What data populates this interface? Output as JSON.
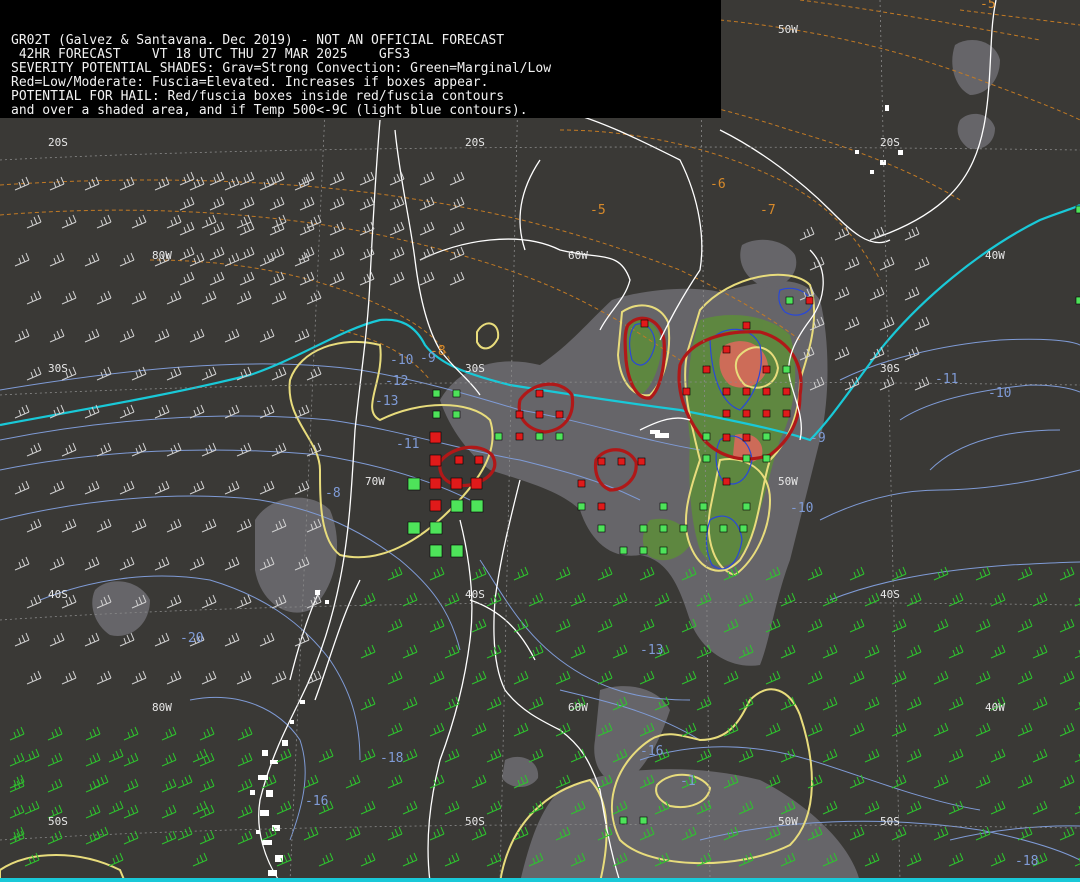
{
  "header": {
    "lines": [
      "GR02T (Galvez & Santavana. Dec 2019) - NOT AN OFFICIAL FORECAST",
      " 42HR FORECAST    VT 18 UTC THU 27 MAR 2025    GFS3",
      "SEVERITY POTENTIAL SHADES: Grav=Strong Convection: Green=Marginal/Low",
      "Red=Low/Moderate: Fuscia=Elevated. Increases if boxes appear.",
      "POTENTIAL FOR HAIL: Red/fuscia boxes inside red/fuscia contours",
      "and over a shaded area, and if Temp 500<-9C (light blue contours)."
    ]
  },
  "grid_labels": {
    "lat_20s_a": "20S",
    "lat_20s_b": "20S",
    "lat_20s_c": "20S",
    "lat_30s_a": "30S",
    "lat_30s_b": "30S",
    "lat_30s_c": "30S",
    "lat_40s_a": "40S",
    "lat_40s_b": "40S",
    "lat_40s_c": "40S",
    "lat_50s_a": "50S",
    "lat_50s_b": "50S",
    "lat_50s_c": "50S",
    "lon_80w_a": "80W",
    "lon_80w_b": "80W",
    "lon_70w": "70W",
    "lon_60w_a": "60W",
    "lon_60w_b": "60W",
    "lon_50w_a": "50W",
    "lon_50w_b": "50W",
    "lon_50w_c": "50W",
    "lon_40w_a": "40W",
    "lon_40w_b": "40W"
  },
  "temp_labels": {
    "t1": "-10",
    "t2": "-12",
    "t3": "-13",
    "t4": "-11",
    "t5": "-8",
    "t6": "-20",
    "t7": "-13",
    "t8": "-18",
    "t9": "-16",
    "t10": "-16",
    "t11": "-11",
    "t12": "-10",
    "t13": "-10",
    "t14": "-18",
    "t15": "-9",
    "t16": "-9",
    "t17": "-1"
  },
  "other_labels": {
    "o1": "-5",
    "o2": "-6",
    "o3": "-7",
    "o4": "-8",
    "o5": "-5"
  },
  "colors": {
    "background": "#3a3936",
    "coast": "#ffffff",
    "shade_gray": "#6e6d72",
    "shade_green": "#5e8b3c",
    "shade_red": "#d36a5a",
    "contour_red": "#b01818",
    "contour_yellow": "#e8dc7c",
    "temp_contour": "#7f9bd6",
    "freezing_line": "#19c9d8",
    "other_contour": "#c27a24",
    "box_red": "#e01a1a",
    "box_green": "#4ee35a",
    "wind_barb_gray": "#d0d0d0",
    "wind_barb_green": "#2ec42e"
  }
}
